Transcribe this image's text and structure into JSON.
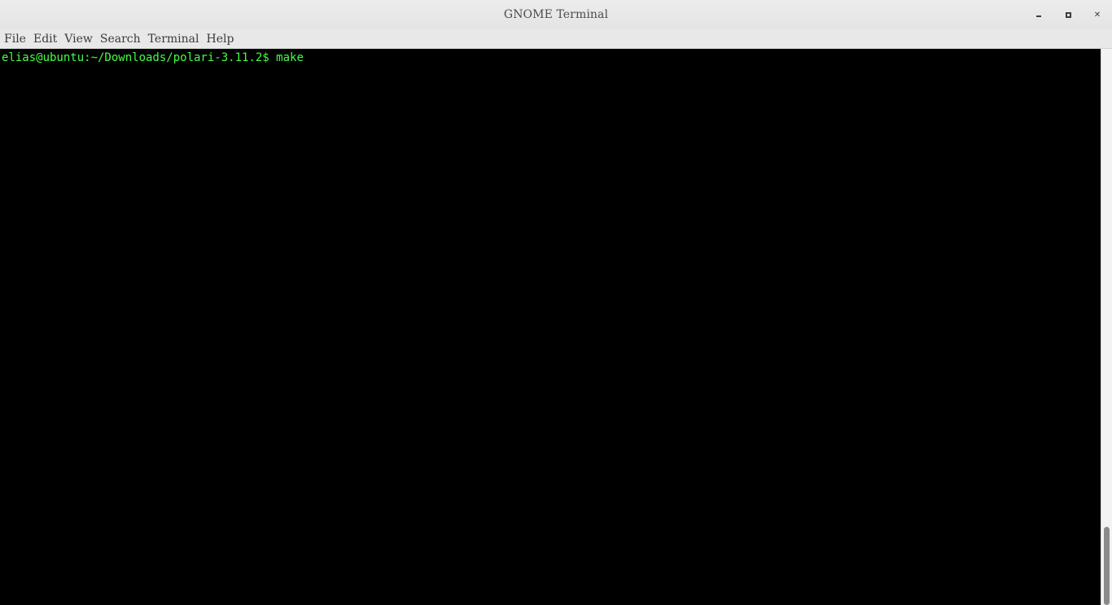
{
  "window": {
    "title": "GNOME Terminal",
    "minimize_label": "minimize-icon",
    "maximize_label": "maximize-icon",
    "close_glyph": "✕"
  },
  "menubar": {
    "items": [
      "File",
      "Edit",
      "View",
      "Search",
      "Terminal",
      "Help"
    ]
  },
  "terminal": {
    "prompt": "elias@ubuntu:~/Downloads/polari-3.11.2$",
    "command": " make",
    "text_color": "#44ff44",
    "background": "#000000"
  },
  "scrollbar": {
    "position": "bottom"
  }
}
